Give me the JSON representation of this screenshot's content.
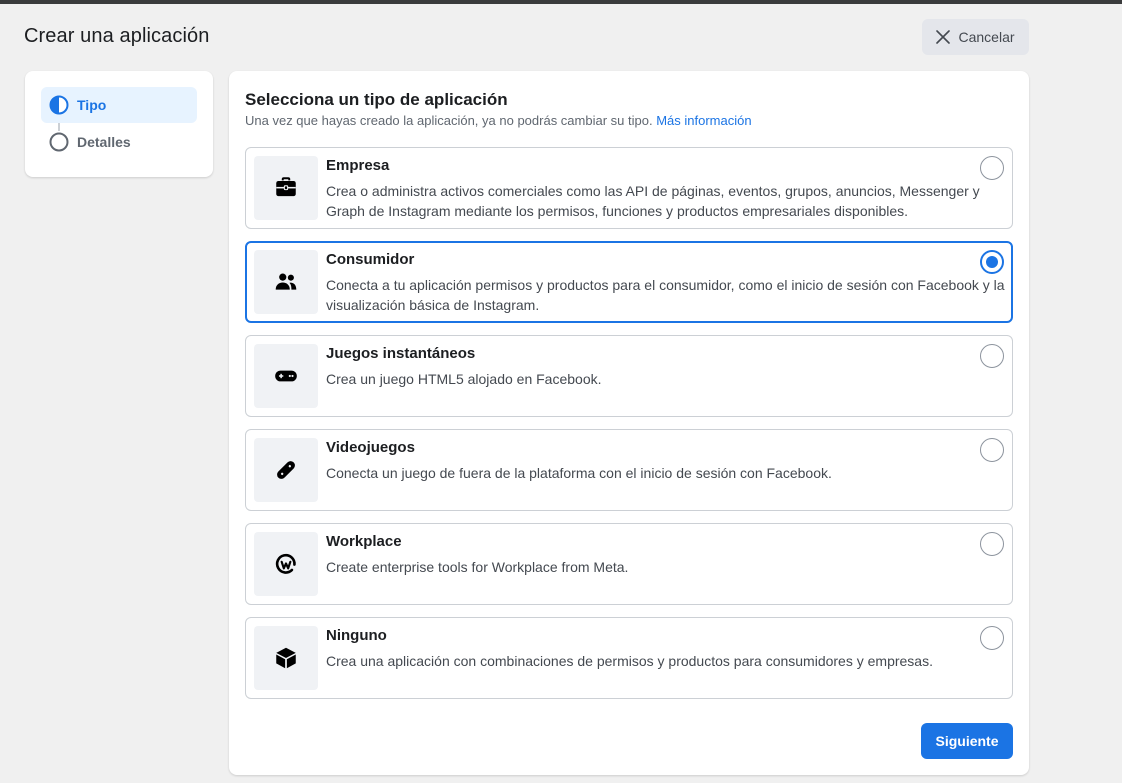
{
  "header": {
    "title": "Crear una aplicación",
    "cancel_label": "Cancelar"
  },
  "steps": [
    {
      "label": "Tipo",
      "icon": "half-circle-icon",
      "active": true
    },
    {
      "label": "Detalles",
      "icon": "empty-circle-icon",
      "active": false
    }
  ],
  "main": {
    "title": "Selecciona un tipo de aplicación",
    "subtitle": "Una vez que hayas creado la aplicación, ya no podrás cambiar su tipo.",
    "more_info_link": "Más información",
    "options": [
      {
        "title": "Empresa",
        "description": "Crea o administra activos comerciales como las API de páginas, eventos, grupos, anuncios, Messenger y Graph de Instagram mediante los permisos, funciones y productos empresariales disponibles.",
        "icon": "briefcase-icon",
        "selected": false
      },
      {
        "title": "Consumidor",
        "description": "Conecta a tu aplicación permisos y productos para el consumidor, como el inicio de sesión con Facebook y la visualización básica de Instagram.",
        "icon": "people-icon",
        "selected": true
      },
      {
        "title": "Juegos instantáneos",
        "description": "Crea un juego HTML5 alojado en Facebook.",
        "icon": "gamepad-icon",
        "selected": false
      },
      {
        "title": "Videojuegos",
        "description": "Conecta un juego de fuera de la plataforma con el inicio de sesión con Facebook.",
        "icon": "game-controller-icon",
        "selected": false
      },
      {
        "title": "Workplace",
        "description": "Create enterprise tools for Workplace from Meta.",
        "icon": "workplace-icon",
        "selected": false
      },
      {
        "title": "Ninguno",
        "description": "Crea una aplicación con combinaciones de permisos y productos para consumidores y empresas.",
        "icon": "cube-icon",
        "selected": false
      }
    ],
    "next_label": "Siguiente"
  },
  "colors": {
    "accent": "#1b74e4",
    "background": "#f0f0f0",
    "card": "#ffffff"
  }
}
